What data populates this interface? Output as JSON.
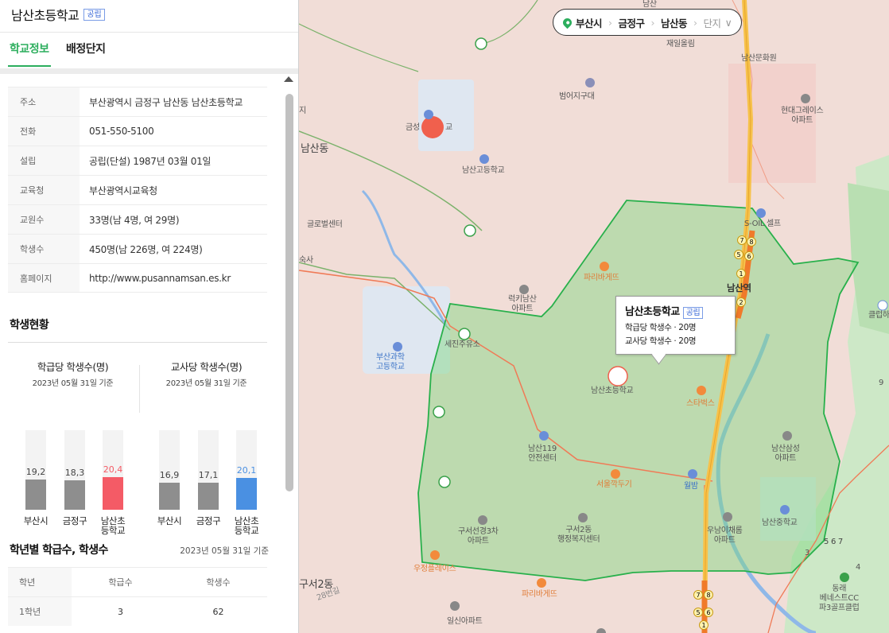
{
  "school": {
    "name": "남산초등학교",
    "type_badge": "공립"
  },
  "tabs": [
    "학교정보",
    "배정단지"
  ],
  "info": [
    {
      "label": "주소",
      "value": "부산광역시 금정구 남산동 남산초등학교"
    },
    {
      "label": "전화",
      "value": "051-550-5100"
    },
    {
      "label": "설립",
      "value": "공립(단설) 1987년 03월 01일"
    },
    {
      "label": "교육청",
      "value": "부산광역시교육청"
    },
    {
      "label": "교원수",
      "value": "33명(남 4명, 여 29명)"
    },
    {
      "label": "학생수",
      "value": "450명(남 226명, 여 224명)"
    },
    {
      "label": "홈페이지",
      "value": "http://www.pusannamsan.es.kr"
    }
  ],
  "student_status": {
    "title": "학생현황"
  },
  "chart_data": [
    {
      "type": "bar",
      "title": "학급당 학생수(명)",
      "subtitle": "2023년 05월 31일 기준",
      "categories": [
        "부산시",
        "금정구",
        "남산초등학교"
      ],
      "values": [
        19.2,
        18.3,
        20.4
      ],
      "value_labels": [
        "19,2",
        "18,3",
        "20,4"
      ],
      "colors": [
        "#8e8e8e",
        "#8e8e8e",
        "#f45b66"
      ],
      "highlight_color": "#f45b66"
    },
    {
      "type": "bar",
      "title": "교사당 학생수(명)",
      "subtitle": "2023년 05월 31일 기준",
      "categories": [
        "부산시",
        "금정구",
        "남산초등학교"
      ],
      "values": [
        16.9,
        17.1,
        20.1
      ],
      "value_labels": [
        "16,9",
        "17,1",
        "20,1"
      ],
      "colors": [
        "#8e8e8e",
        "#8e8e8e",
        "#4a90e2"
      ],
      "highlight_color": "#4a90e2"
    }
  ],
  "bar_labels": [
    [
      "부산시",
      "금정구",
      "남산초",
      "등학교"
    ],
    [
      "부산시",
      "금정구",
      "남산초",
      "등학교"
    ]
  ],
  "grades": {
    "title": "학년별 학급수, 학생수",
    "date": "2023년 05월 31일 기준",
    "headers": [
      "학년",
      "학급수",
      "학생수"
    ],
    "rows": [
      {
        "grade": "1학년",
        "classes": "3",
        "students": "62"
      }
    ]
  },
  "breadcrumb": {
    "items": [
      "부산시",
      "금정구",
      "남산동"
    ],
    "last": "단지",
    "accent": "#2cae5d"
  },
  "popup": {
    "name": "남산초등학교",
    "badge": "공립",
    "line1": "학급당 학생수 · 20명",
    "line2": "교사당 학생수 · 20명"
  },
  "map_labels": {
    "namsan_elementary": "남산초등학교",
    "namsan_dong": "남산동",
    "namsan_station": "남산역",
    "namsan_high": "남산고등학교",
    "busan_science": "부산과학\n고등학교",
    "beomeo": "범어지구대",
    "geumseong": "금성",
    "geumseong_tail": "교",
    "hyundai": "현대그레이스\n아파트",
    "namsan_culture": "남산문화원",
    "jaeil": "재일올림",
    "s_oil": "S-OIL 셀프",
    "global": "글로벌센터",
    "suksa": "숙사",
    "paris1": "파리바게뜨",
    "lucky": "럭키남산\n아파트",
    "sejin": "세진주유소",
    "starbucks": "스타벅스",
    "namsan119": "남산119\n안전센터",
    "seoul": "서울깍두기",
    "woori": "월밤",
    "namsan_samsung": "남산삼성\n아파트",
    "guseo_apt": "구서선경3차\n아파트",
    "guseo2": "구서2동\n행정복지센터",
    "usan": "우남이채롬\n아파트",
    "namsan_middle": "남산중학교",
    "jimplace": "우정플레이스",
    "paris2": "파리바게뜨",
    "ilsin": "일신아파트",
    "dongrae": "동래\n베네스트CC\n파3골프클럽",
    "club": "클럽하우",
    "guseo_dong": "구서2동",
    "road28": "28번길",
    "road_ji": "지",
    "top_label": "남산",
    "num9": "9",
    "golf_nums": "5  6  7",
    "golf_num3": "3",
    "golf_num4": "4"
  },
  "subway_numbers": [
    "7",
    "8",
    "5",
    "6",
    "1",
    "2"
  ],
  "colors": {
    "accent": "#2cae5d",
    "zone_fill": "#7fd67f",
    "zone_stroke": "#28b04b",
    "school_red": "#f0604d",
    "line_orange": "#f07a2a",
    "water": "#8fb8e8"
  }
}
